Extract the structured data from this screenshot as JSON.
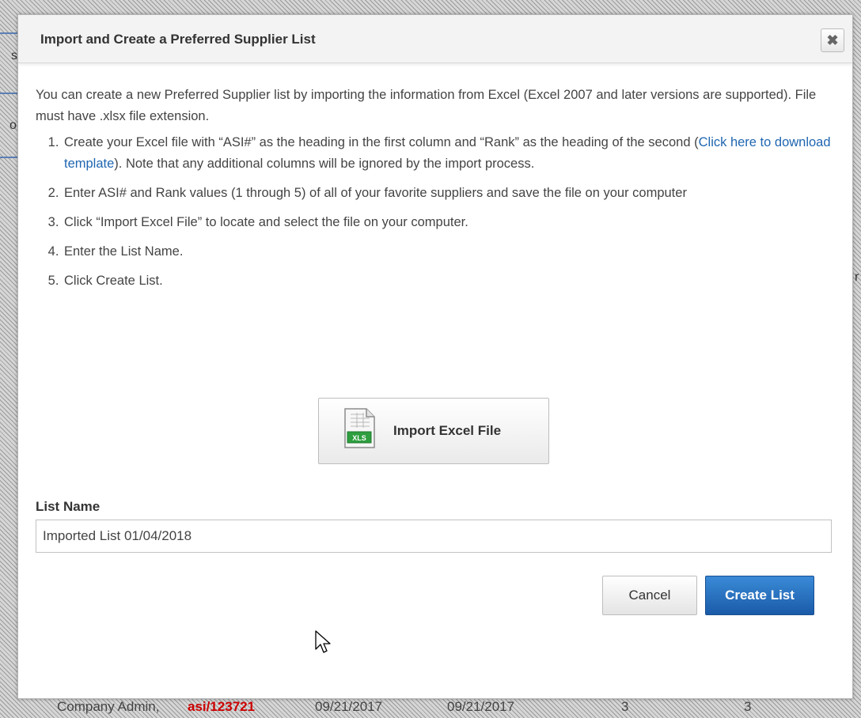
{
  "dialog": {
    "title": "Import and Create a Preferred Supplier List",
    "close_icon": "close-icon",
    "intro": "You can create a new Preferred Supplier list by importing the information from Excel (Excel 2007 and later versions are supported). File must have .xlsx file extension.",
    "steps": {
      "step1_before": "Create your Excel file with “ASI#” as the heading in the first column and “Rank” as the heading of the second (",
      "step1_link": "Click here to download template",
      "step1_after": "). Note that any additional columns will be ignored by the import process.",
      "step2": "Enter ASI# and Rank values (1 through 5) of all of your favorite suppliers and save the file on your computer",
      "step3": "Click “Import Excel File” to locate and select the file on your computer.",
      "step4": "Enter the List Name.",
      "step5": "Click Create List."
    },
    "import_button": {
      "label": "Import Excel File",
      "icon": "xls-file-icon",
      "icon_text": "XLS"
    },
    "list_name": {
      "label": "List Name",
      "value": "Imported List 01/04/2018"
    },
    "buttons": {
      "cancel": "Cancel",
      "create": "Create List"
    }
  },
  "background": {
    "fragments": {
      "frag1": "st",
      "frag2": "or",
      "frag3": "r"
    },
    "row": {
      "role": "Company Admin,",
      "user": "asi/123721",
      "date1": "09/21/2017",
      "date2": "09/21/2017",
      "count1": "3",
      "count2": "3"
    }
  },
  "colors": {
    "primary_button": "#1a5ba8",
    "link": "#1f66b1"
  }
}
